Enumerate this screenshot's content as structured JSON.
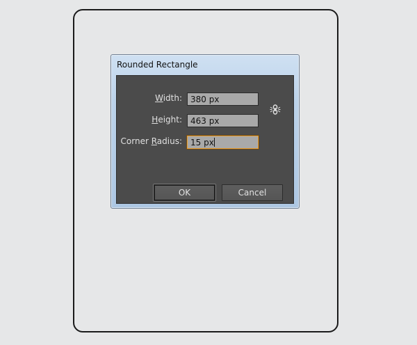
{
  "dialog": {
    "title": "Rounded Rectangle",
    "fields": {
      "width": {
        "label_underline": "W",
        "label_rest": "idth:",
        "value": "380 px"
      },
      "height": {
        "label_underline": "H",
        "label_rest": "eight:",
        "value": "463 px"
      },
      "corner_radius": {
        "label_pre": "Corner ",
        "label_underline": "R",
        "label_rest": "adius:",
        "value": "15 px"
      }
    },
    "buttons": {
      "ok": "OK",
      "cancel": "Cancel"
    },
    "icons": {
      "constrain": "link-proportions-icon"
    }
  },
  "colors": {
    "dialog_body": "#4b4b4b",
    "input_bg": "#a9a9a9",
    "focus_border": "#e8a035",
    "page_bg": "#e6e7e8"
  }
}
